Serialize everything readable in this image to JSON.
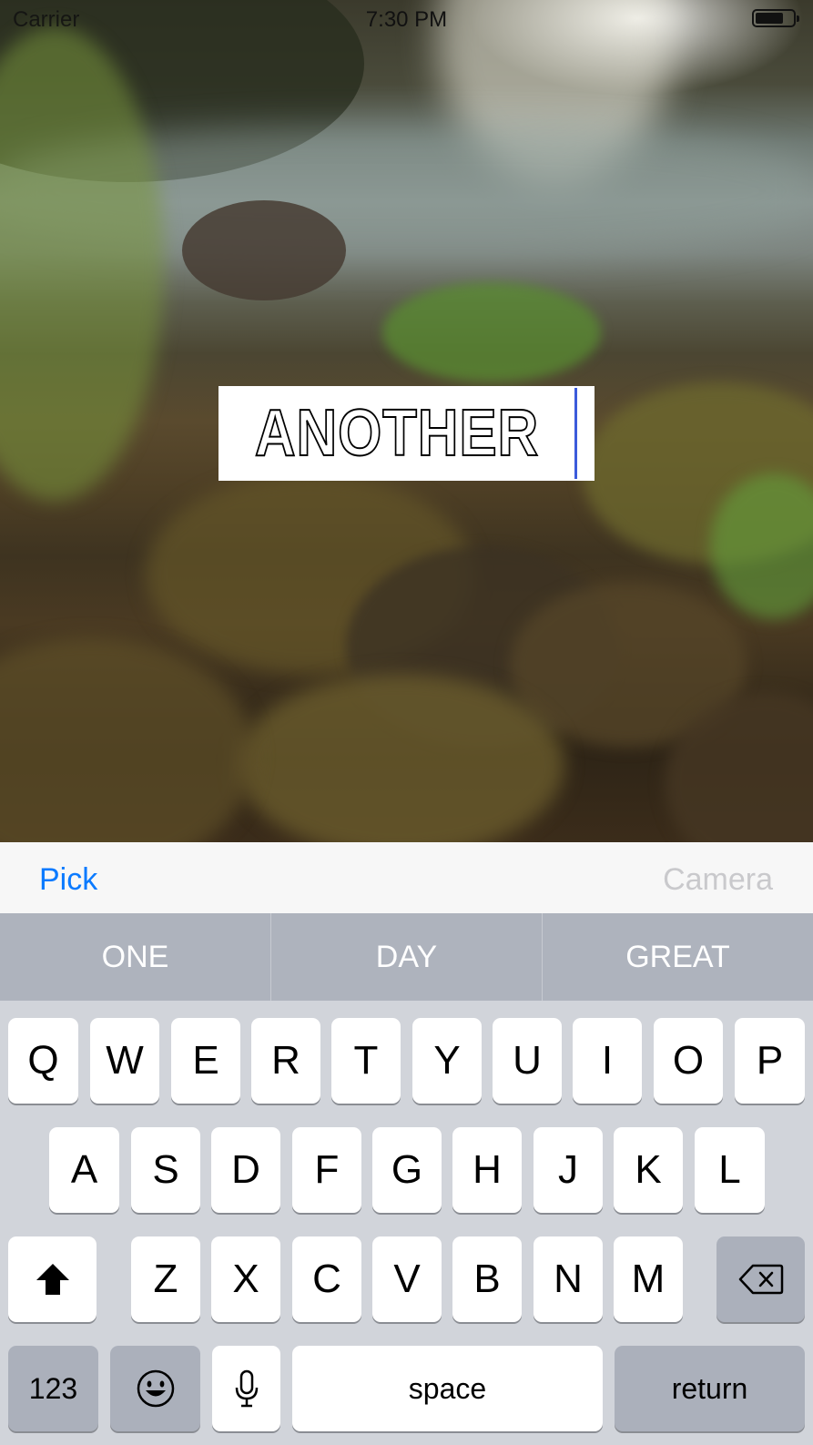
{
  "status_bar": {
    "carrier": "Carrier",
    "time": "7:30 PM"
  },
  "caption": {
    "text": "ANOTHER"
  },
  "toolbar": {
    "pick_label": "Pick",
    "camera_label": "Camera"
  },
  "suggestions": [
    "ONE",
    "DAY",
    "GREAT"
  ],
  "keyboard": {
    "row1": [
      "Q",
      "W",
      "E",
      "R",
      "T",
      "Y",
      "U",
      "I",
      "O",
      "P"
    ],
    "row2": [
      "A",
      "S",
      "D",
      "F",
      "G",
      "H",
      "J",
      "K",
      "L"
    ],
    "row3": [
      "Z",
      "X",
      "C",
      "V",
      "B",
      "N",
      "M"
    ],
    "numbers_label": "123",
    "space_label": "space",
    "return_label": "return",
    "icons": {
      "shift": "shift-icon",
      "delete": "backspace-icon",
      "emoji": "emoji-icon",
      "dictation": "microphone-icon"
    }
  },
  "colors": {
    "accent": "#0a7aff",
    "disabled": "#c9c9cc",
    "caret": "#3b5bdb"
  }
}
